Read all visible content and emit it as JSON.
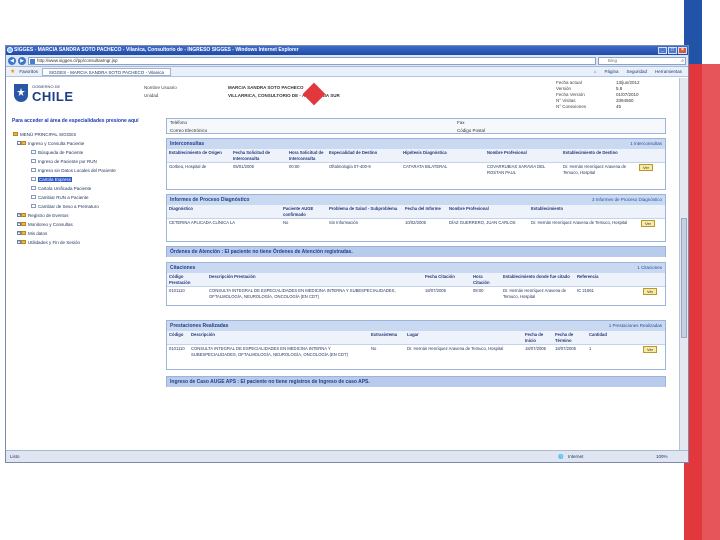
{
  "window": {
    "title": "SIGGES - MARCIA SANDRA SOTO PACHECO - Vilanica, Consultorio de - INGRESO SIGGES - Windows Internet Explorer",
    "address": "http://www.sigges.cl/pp/consultasIngr.jsp",
    "search_placeholder": "Bing",
    "favorites_label": "Favoritos",
    "tab_label": "SIGGES - MARCIA SANDRA SOTO PACHECO - Vilanica",
    "toolbar": [
      "Página",
      "Seguridad",
      "Herramientas"
    ],
    "status_left": "Listo",
    "status_zone": "Internet",
    "zoom": "100%"
  },
  "header": {
    "gob": "GOBIERNO DE",
    "chile": "CHILE",
    "labels": [
      "Nombre Usuario",
      "Unidad"
    ],
    "values": [
      "MARCIA SANDRA SOTO PACHECO",
      "VILLARRICA, CONSULTORIO DE - ARAUCANIA SUR"
    ],
    "meta_labels": [
      "Fecha actual",
      "Versión",
      "Fecha Versión",
      "N° Visitas",
      "N° Conexiones"
    ],
    "meta_values": [
      "13/jun/2012",
      "5.8",
      "01/07/2010",
      "3394560",
      "45"
    ]
  },
  "sidebar": {
    "title": "Para acceder al área de especialidades presione aquí",
    "items": [
      {
        "label": "MENÚ PRINCIPAL SIGGES",
        "level": 0,
        "pm": ""
      },
      {
        "label": "Ingreso y Consulta Paciente",
        "level": 1,
        "pm": "-"
      },
      {
        "label": "Búsqueda de Paciente",
        "level": 2,
        "pm": ""
      },
      {
        "label": "Ingreso de Paciente por RUN",
        "level": 2,
        "pm": ""
      },
      {
        "label": "Ingreso sin Datos Locales del Paciente",
        "level": 2,
        "pm": ""
      },
      {
        "label": "Cartola Express",
        "level": 2,
        "pm": "",
        "selected": true
      },
      {
        "label": "Cartola Unificada Paciente",
        "level": 2,
        "pm": ""
      },
      {
        "label": "Cambiar RUN a Paciente",
        "level": 2,
        "pm": ""
      },
      {
        "label": "Cambiar de Sexo a Prematuro",
        "level": 2,
        "pm": ""
      },
      {
        "label": "Registro de Eventos",
        "level": 1,
        "pm": "+"
      },
      {
        "label": "Monitoreo y Consultas",
        "level": 1,
        "pm": "+"
      },
      {
        "label": "Mis datos",
        "level": 1,
        "pm": "+"
      },
      {
        "label": "Utilidades y Fin de Sesión",
        "level": 1,
        "pm": "+"
      }
    ]
  },
  "top_fields": {
    "telefono": "Teléfono",
    "fax": "Fax",
    "correo": "Correo Electrónico",
    "codigo_postal": "Código Postal"
  },
  "interconsultas": {
    "title": "Interconsultas",
    "count": "1 Interconsultas",
    "headers": [
      "Establecimiento de Origen",
      "Fecha Solicitud de Interconsulta",
      "Hora Solicitud de Interconsulta",
      "Especialidad de Destino",
      "Hipótesis Diagnóstica",
      "Nombre Profesional",
      "Establecimiento de Destino",
      ""
    ],
    "row": [
      "Gorbea, Hospital de",
      "05/01/2005",
      "00:00",
      "Oftalmología 07-400-9",
      "CATARATA BILATERAL",
      "COVARRUBIAS SARAVIA DEL ROSTAN PAUL",
      "Dr. Hernán Henríquez Aravena de Temuco, Hospital",
      "Ver"
    ]
  },
  "informes": {
    "title": "Informes de Proceso Diagnóstico",
    "count": "3 Informes de Proceso Diagnóstico",
    "headers": [
      "Diagnóstico",
      "Paciente AUGE confirmado",
      "Problema de Salud - Subproblema",
      "Fecha del Informe",
      "Nombre Profesional",
      "Establecimiento",
      ""
    ],
    "row": [
      "CETERINA APLICADA CLÍNICA LA",
      "No",
      "Sin Información",
      "10/02/2005",
      "DÍAZ GUERRERO, JUAN CARLOS",
      "Dr. Hernán Henríquez Aravena de Temuco, Hospital",
      "Ver"
    ]
  },
  "ordenes": {
    "title": "Órdenes de Atención : El paciente no tiene Órdenes de Atención registradas."
  },
  "citaciones": {
    "title": "Citaciones",
    "count": "1 Citaciones",
    "headers": [
      "Código Prestación",
      "Descripción Prestación",
      "Fecha Citación",
      "Hora Citación",
      "Establecimiento donde fue citado",
      "Referencia",
      ""
    ],
    "row": [
      "0101110",
      "CONSULTA INTEGRAL DE ESPECIALIDADES EN MEDICINA INTERNA Y SUBESPECIALIDADES, OFTALMOLOGÍA, NEUROLOGÍA, ONCOLOGÍA (EN CDT)",
      "18/07/2005",
      "08:00",
      "Dr. Hernán Henríquez Aravena de Temuco, Hospital",
      "IC 21661",
      "Ver"
    ]
  },
  "prestaciones": {
    "title": "Prestaciones Realizadas",
    "count": "1 Prestaciones Realizadas",
    "headers": [
      "Código",
      "Descripción",
      "Extrasistema",
      "Lugar",
      "Fecha de Inicio",
      "Fecha de Término",
      "Cantidad",
      ""
    ],
    "row": [
      "0101110",
      "CONSULTA INTEGRAL DE ESPECIALIDADES EN MEDICINA INTERNA Y SUBESPECIALIDADES, OFTALMOLOGÍA, NEUROLOGÍA, ONCOLOGÍA (EN CDT)",
      "No",
      "Dr. Hernán Henríquez Aravena de Temuco, Hospital",
      "18/07/2005",
      "18/07/2005",
      "1",
      "Ver"
    ]
  },
  "ingreso_auge": {
    "title": "Ingreso de Caso AUGE APS : El paciente no tiene registros de Ingreso de caso APS."
  }
}
